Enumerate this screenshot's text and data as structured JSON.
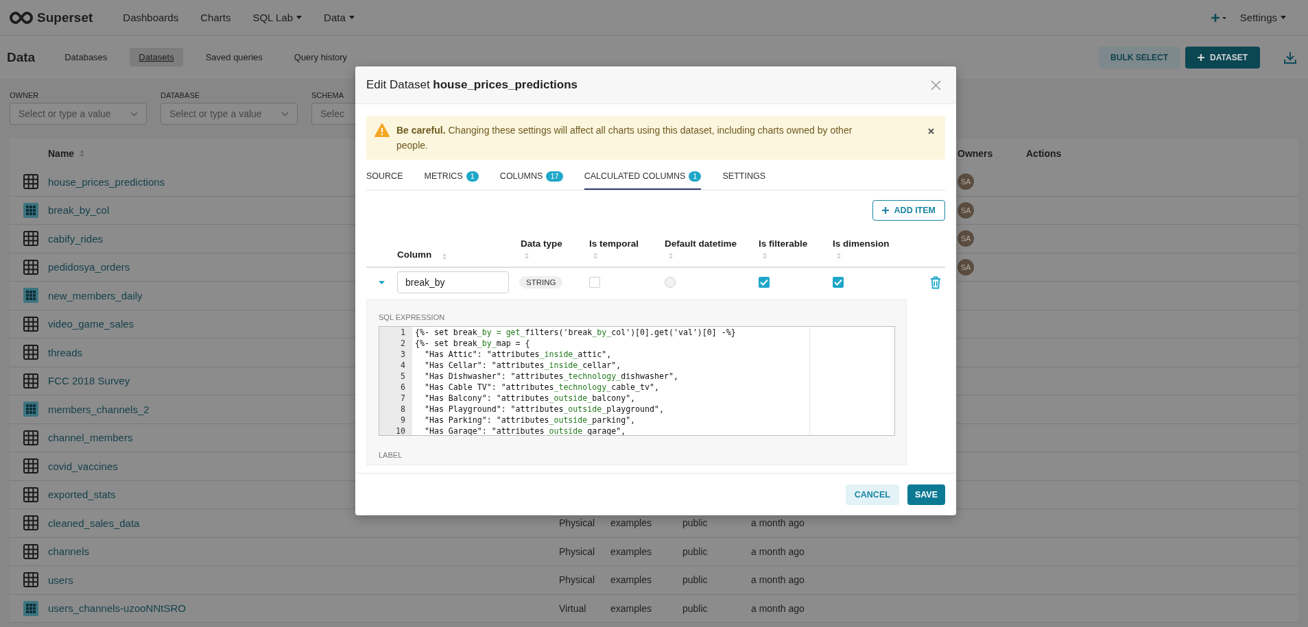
{
  "navbar": {
    "brand": "Superset",
    "menu": [
      {
        "label": "Dashboards",
        "dropdown": false
      },
      {
        "label": "Charts",
        "dropdown": false
      },
      {
        "label": "SQL Lab",
        "dropdown": true
      },
      {
        "label": "Data",
        "dropdown": true
      }
    ],
    "settings": "Settings"
  },
  "subheader": {
    "title": "Data",
    "tabs": [
      {
        "label": "Databases",
        "selected": false
      },
      {
        "label": "Datasets",
        "selected": true
      },
      {
        "label": "Saved queries",
        "selected": false
      },
      {
        "label": "Query history",
        "selected": false
      }
    ],
    "buttons": [
      {
        "label": "BULK SELECT",
        "kind": "secondary"
      },
      {
        "label": "DATASET",
        "kind": "primary"
      }
    ]
  },
  "filters": [
    {
      "label": "OWNER",
      "placeholder": "Select or type a value"
    },
    {
      "label": "DATABASE",
      "placeholder": "Select or type a value"
    },
    {
      "label": "SCHEMA",
      "placeholder": "Selec"
    }
  ],
  "table": {
    "columns": {
      "name": "Name",
      "owners": "Owners",
      "actions": "Actions"
    },
    "rows": [
      {
        "name": "house_prices_predictions",
        "kind": "physical",
        "owner": "SA"
      },
      {
        "name": "break_by_col",
        "kind": "virtual",
        "owner": "SA"
      },
      {
        "name": "cabify_rides",
        "kind": "physical",
        "owner": "SA"
      },
      {
        "name": "pedidosya_orders",
        "kind": "physical",
        "owner": "SA"
      },
      {
        "name": "new_members_daily",
        "kind": "virtual"
      },
      {
        "name": "video_game_sales",
        "kind": "physical"
      },
      {
        "name": "threads",
        "kind": "physical"
      },
      {
        "name": "FCC 2018 Survey",
        "kind": "physical"
      },
      {
        "name": "members_channels_2",
        "kind": "virtual"
      },
      {
        "name": "channel_members",
        "kind": "physical"
      },
      {
        "name": "covid_vaccines",
        "kind": "physical"
      },
      {
        "name": "exported_stats",
        "kind": "physical"
      },
      {
        "name": "cleaned_sales_data",
        "kind": "physical",
        "type": "Physical",
        "database": "examples",
        "schema": "public",
        "modified": "a month ago"
      },
      {
        "name": "channels",
        "kind": "physical",
        "type": "Physical",
        "database": "examples",
        "schema": "public",
        "modified": "a month ago"
      },
      {
        "name": "users",
        "kind": "physical",
        "type": "Physical",
        "database": "examples",
        "schema": "public",
        "modified": "a month ago"
      },
      {
        "name": "users_channels-uzooNNtSRO",
        "kind": "virtual",
        "type": "Virtual",
        "database": "examples",
        "schema": "public",
        "modified": "a month ago"
      }
    ]
  },
  "modal": {
    "title": "Edit Dataset **house_prices_predictions**",
    "alert": "**Be careful.** Changing these settings will affect all charts using this dataset, including charts owned by other people.",
    "tabs": [
      {
        "label": "SOURCE",
        "selected": false
      },
      {
        "label": "METRICS",
        "count": "1",
        "selected": false
      },
      {
        "label": "COLUMNS",
        "count": "17",
        "selected": false
      },
      {
        "label": "CALCULATED COLUMNS",
        "count": "1",
        "selected": true
      },
      {
        "label": "SETTINGS",
        "selected": false
      }
    ],
    "add_item": "ADD ITEM",
    "columns": [
      "Column",
      "Data type",
      "Is temporal",
      "Default datetime",
      "Is filterable",
      "Is dimension"
    ],
    "row": {
      "expanded": true,
      "name": "break_by",
      "data_type": "STRING",
      "is_temporal": false,
      "default_datetime": false,
      "is_filterable": true,
      "is_dimension": true
    },
    "sql_label": "SQL EXPRESSION",
    "code_lines": [
      {
        "number": "1",
        "segments": [
          "{%- set break",
          "_by = get_",
          "filters('break",
          "_by_",
          "col')[0].get('val')[0] -%}"
        ]
      },
      {
        "number": "2",
        "segments": [
          "{%- set break",
          "_by_",
          "map = {"
        ]
      },
      {
        "number": "3",
        "segments": [
          "  \"Has Attic\": \"attributes",
          "_inside_",
          "attic\","
        ]
      },
      {
        "number": "4",
        "segments": [
          "  \"Has Cellar\": \"attributes",
          "_inside_",
          "cellar\","
        ]
      },
      {
        "number": "5",
        "segments": [
          "  \"Has Dishwasher\": \"attributes",
          "_technology_",
          "dishwasher\","
        ]
      },
      {
        "number": "6",
        "segments": [
          "  \"Has Cable TV\": \"attributes",
          "_technology_",
          "cable_tv\","
        ]
      },
      {
        "number": "7",
        "segments": [
          "  \"Has Balcony\": \"attributes",
          "_outside_",
          "balcony\","
        ]
      },
      {
        "number": "8",
        "segments": [
          "  \"Has Playground\": \"attributes",
          "_outside_",
          "playground\","
        ]
      },
      {
        "number": "9",
        "segments": [
          "  \"Has Parking\": \"attributes",
          "_outside_",
          "parking\","
        ]
      },
      {
        "number": "10",
        "segments": [
          "  \"Has Garage\": \"attributes",
          "_outside_",
          "garage\","
        ]
      }
    ],
    "label_label": "LABEL",
    "buttons": [
      {
        "label": "CANCEL",
        "kind": "secondary"
      },
      {
        "label": "SAVE",
        "kind": "primary"
      }
    ]
  }
}
